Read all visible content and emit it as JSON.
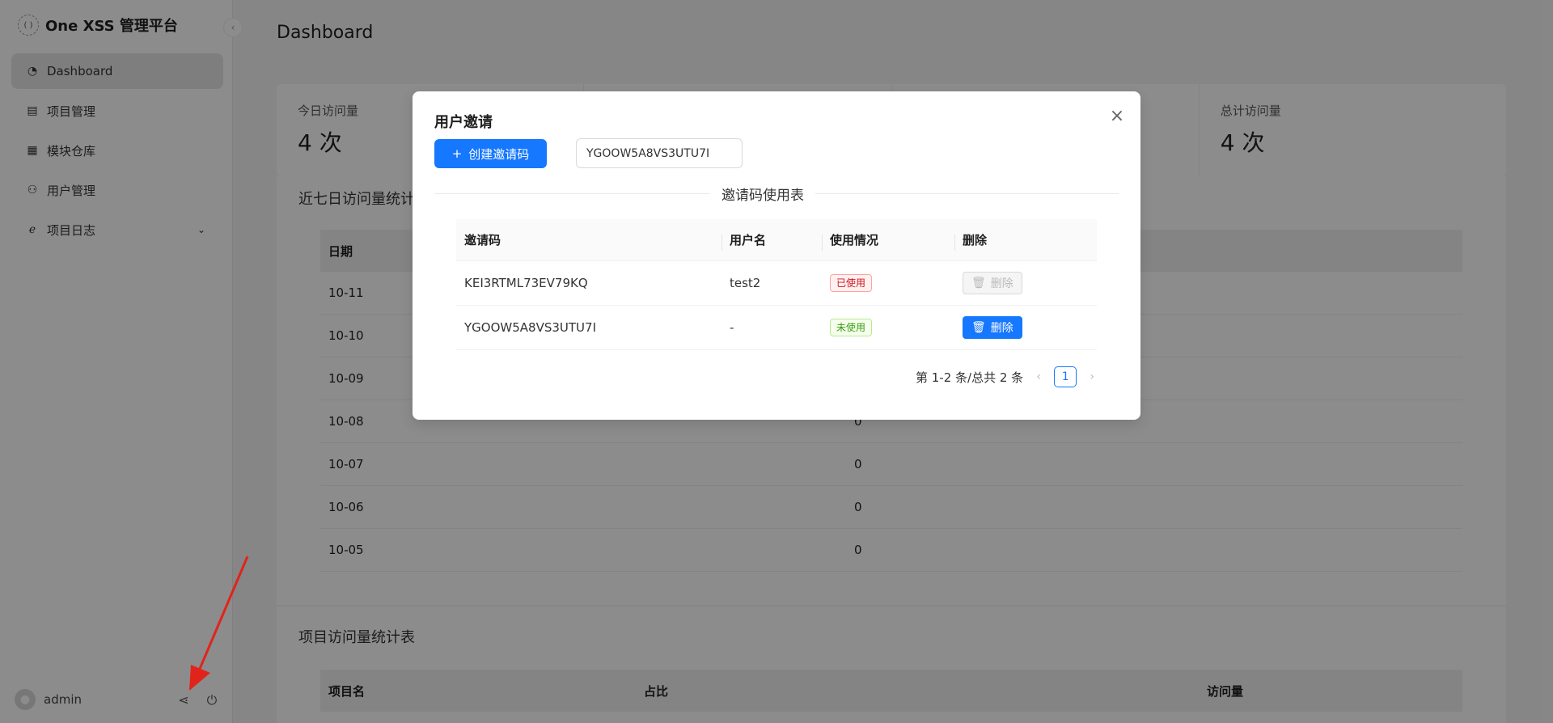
{
  "app": {
    "title": "One XSS 管理平台",
    "logo_text": "(  )"
  },
  "sidebar": {
    "items": [
      {
        "label": "Dashboard",
        "icon": "dashboard-icon"
      },
      {
        "label": "项目管理",
        "icon": "project-icon"
      },
      {
        "label": "模块仓库",
        "icon": "module-icon"
      },
      {
        "label": "用户管理",
        "icon": "user-icon"
      },
      {
        "label": "项目日志",
        "icon": "log-icon"
      }
    ],
    "collapse_glyph": "‹",
    "chevron_glyph": "⌄",
    "user": {
      "name": "admin"
    }
  },
  "main": {
    "title": "Dashboard",
    "stats": [
      {
        "label": "今日访问量",
        "value": "4 次"
      },
      {
        "label": "",
        "value": ""
      },
      {
        "label": "",
        "value": ""
      },
      {
        "label": "总计访问量",
        "value": "4 次"
      }
    ],
    "week_section": {
      "title": "近七日访问量统计",
      "header_date": "日期",
      "rows": [
        {
          "date": "10-11",
          "value": ""
        },
        {
          "date": "10-10",
          "value": ""
        },
        {
          "date": "10-09",
          "value": ""
        },
        {
          "date": "10-08",
          "value": "0"
        },
        {
          "date": "10-07",
          "value": "0"
        },
        {
          "date": "10-06",
          "value": "0"
        },
        {
          "date": "10-05",
          "value": "0"
        }
      ]
    },
    "project_section": {
      "title": "项目访问量统计表",
      "headers": [
        "项目名",
        "占比",
        "访问量"
      ]
    }
  },
  "modal": {
    "title": "用户邀请",
    "create_button": "创建邀请码",
    "plus_glyph": "+",
    "close_glyph": "×",
    "generated_code": "YGOOW5A8VS3UTU7I",
    "table_title": "邀请码使用表",
    "headers": [
      "邀请码",
      "用户名",
      "使用情况",
      "删除"
    ],
    "rows": [
      {
        "code": "KEI3RTML73EV79KQ",
        "username": "test2",
        "status": "已使用",
        "delete_label": "删除"
      },
      {
        "code": "YGOOW5A8VS3UTU7I",
        "username": "-",
        "status": "未使用",
        "delete_label": "删除"
      }
    ],
    "pagination": {
      "summary": "第 1-2 条/总共 2 条",
      "current_page": "1",
      "prev_glyph": "‹",
      "next_glyph": "›"
    }
  },
  "colors": {
    "primary": "#1677ff",
    "danger": "#cf1322",
    "success": "#389e0d",
    "arrow": "#e0241c"
  }
}
